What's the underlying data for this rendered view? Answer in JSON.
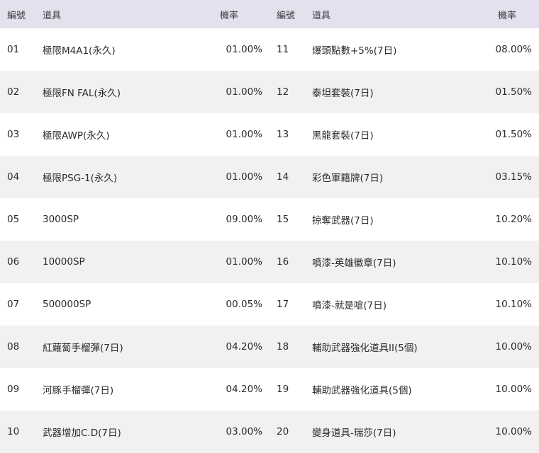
{
  "headers": {
    "no_left": "編號",
    "item_left": "道具",
    "rate_left": "機率",
    "no_right": "編號",
    "item_right": "道具",
    "rate_right": "機率"
  },
  "rows": [
    {
      "no1": "01",
      "item1": "極限M4A1(永久)",
      "rate1": "01.00%",
      "no2": "11",
      "item2": "爆頭點數+5%(7日)",
      "rate2": "08.00%"
    },
    {
      "no1": "02",
      "item1": "極限FN FAL(永久)",
      "rate1": "01.00%",
      "no2": "12",
      "item2": "泰坦套裝(7日)",
      "rate2": "01.50%"
    },
    {
      "no1": "03",
      "item1": "極限AWP(永久)",
      "rate1": "01.00%",
      "no2": "13",
      "item2": "黑龍套裝(7日)",
      "rate2": "01.50%"
    },
    {
      "no1": "04",
      "item1": "極限PSG-1(永久)",
      "rate1": "01.00%",
      "no2": "14",
      "item2": "彩色軍籍牌(7日)",
      "rate2": "03.15%"
    },
    {
      "no1": "05",
      "item1": "3000SP",
      "rate1": "09.00%",
      "no2": "15",
      "item2": "掠奪武器(7日)",
      "rate2": "10.20%"
    },
    {
      "no1": "06",
      "item1": "10000SP",
      "rate1": "01.00%",
      "no2": "16",
      "item2": "噴漆-英雄徽章(7日)",
      "rate2": "10.10%"
    },
    {
      "no1": "07",
      "item1": "500000SP",
      "rate1": "00.05%",
      "no2": "17",
      "item2": "噴漆-就是嗆(7日)",
      "rate2": "10.10%"
    },
    {
      "no1": "08",
      "item1": "紅蘿蔔手榴彈(7日)",
      "rate1": "04.20%",
      "no2": "18",
      "item2": "輔助武器強化道具II(5個)",
      "rate2": "10.00%"
    },
    {
      "no1": "09",
      "item1": "河豚手榴彈(7日)",
      "rate1": "04.20%",
      "no2": "19",
      "item2": "輔助武器強化道具(5個)",
      "rate2": "10.00%"
    },
    {
      "no1": "10",
      "item1": "武器增加C.D(7日)",
      "rate1": "03.00%",
      "no2": "20",
      "item2": "變身道具-瑞莎(7日)",
      "rate2": "10.00%"
    }
  ]
}
